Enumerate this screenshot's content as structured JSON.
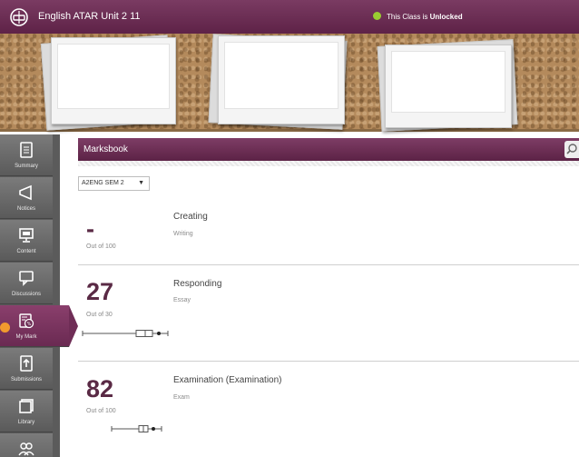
{
  "header": {
    "class_title": "English ATAR Unit 2 11",
    "status_prefix": "This Class is",
    "status_value": "Unlocked",
    "status_color": "#9acd32"
  },
  "sidebar": {
    "items": [
      {
        "label": "Summary",
        "icon": "document-icon"
      },
      {
        "label": "Notices",
        "icon": "megaphone-icon"
      },
      {
        "label": "Content",
        "icon": "monitor-icon"
      },
      {
        "label": "Discussions",
        "icon": "chat-icon"
      },
      {
        "label": "My Mark",
        "icon": "marks-icon"
      },
      {
        "label": "Submissions",
        "icon": "upload-icon"
      },
      {
        "label": "Library",
        "icon": "library-icon"
      },
      {
        "label": "",
        "icon": "people-icon"
      }
    ],
    "active_index": 4
  },
  "marksbook": {
    "title": "Marksbook",
    "semester_select": "A2ENG SEM 2",
    "assessments": [
      {
        "score": "-",
        "out_of": "Out of 100",
        "title": "Creating",
        "subtitle": "Writing"
      },
      {
        "score": "27",
        "out_of": "Out of 30",
        "title": "Responding",
        "subtitle": "Essay"
      },
      {
        "score": "82",
        "out_of": "Out of 100",
        "title": "Examination (Examination)",
        "subtitle": "Exam"
      }
    ]
  },
  "colors": {
    "brand": "#6a2a52",
    "score_text": "#5a2a45",
    "notification": "#f29a2e"
  }
}
